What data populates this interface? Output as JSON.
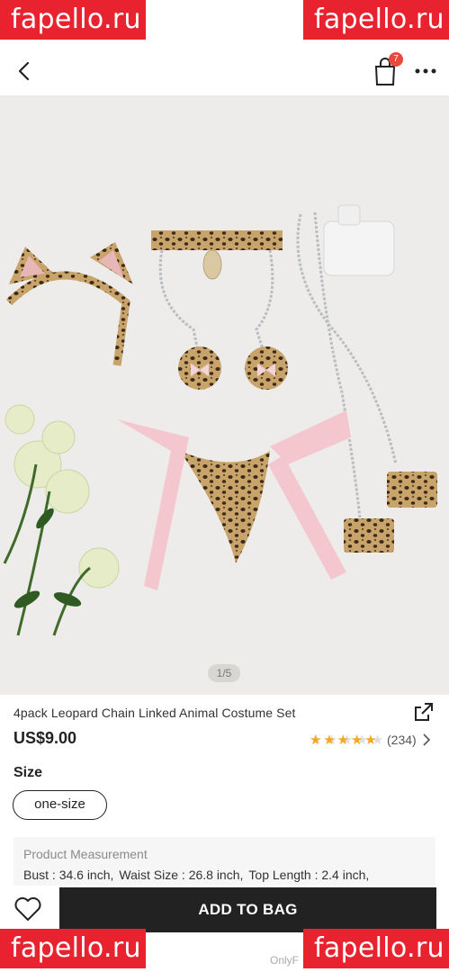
{
  "watermark": {
    "text": "fapello.ru",
    "color": "#e8232f"
  },
  "navbar": {
    "back_icon": "chevron-left-icon",
    "bag_icon": "shopping-bag-icon",
    "bag_count": "7",
    "more_icon": "more-horizontal-icon"
  },
  "gallery": {
    "pager": "1/5"
  },
  "product": {
    "title": "4pack Leopard Chain Linked Animal Costume Set",
    "price": "US$9.00",
    "rating": 4.5,
    "review_count": "(234)",
    "share_icon": "share-external-icon"
  },
  "size": {
    "label": "Size",
    "option": "one-size"
  },
  "measurement": {
    "title": "Product Measurement",
    "items": [
      {
        "key": "Bust : ",
        "value": "34.6 inch,"
      },
      {
        "key": "Waist Size : ",
        "value": "26.8 inch,"
      },
      {
        "key": "Top Length : ",
        "value": "2.4 inch,"
      }
    ]
  },
  "bottom": {
    "wishlist_icon": "heart-outline-icon",
    "add_label": "ADD TO BAG",
    "footer": "OnlyF"
  },
  "colors": {
    "accent": "#222222",
    "star": "#f5a623",
    "badge": "#e9493c",
    "gallery_bg": "#edecea"
  }
}
